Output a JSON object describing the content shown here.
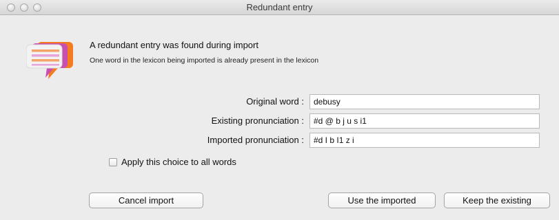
{
  "window": {
    "title": "Redundant entry"
  },
  "message": {
    "heading": "A redundant entry was found during import",
    "detail": "One word in the lexicon being imported is already present in the lexicon"
  },
  "fields": {
    "original_word": {
      "label": "Original word :",
      "value": "debusy"
    },
    "existing_pronunciation": {
      "label": "Existing pronunciation :",
      "value": "#d @ b j u s i1"
    },
    "imported_pronunciation": {
      "label": "Imported pronunciation :",
      "value": "#d I b I1 z i"
    }
  },
  "apply_all": {
    "label": "Apply this choice to all words",
    "checked": false
  },
  "buttons": {
    "cancel": "Cancel import",
    "use_imported": "Use the imported",
    "keep_existing": "Keep the existing"
  },
  "icons": {
    "app": "speech-bubble-lexicon-icon"
  }
}
